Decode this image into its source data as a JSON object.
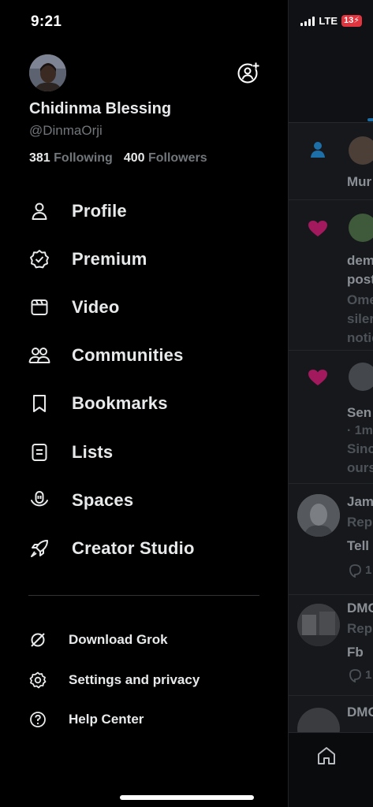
{
  "status_bar": {
    "time": "9:21",
    "network": "LTE",
    "battery": "13"
  },
  "profile": {
    "name": "Chidinma Blessing",
    "handle": "@DinmaOrji",
    "following_count": "381",
    "following_label": "Following",
    "followers_count": "400",
    "followers_label": "Followers"
  },
  "menu": {
    "items": [
      {
        "label": "Profile",
        "icon": "person-icon"
      },
      {
        "label": "Premium",
        "icon": "verified-badge-icon"
      },
      {
        "label": "Video",
        "icon": "video-icon"
      },
      {
        "label": "Communities",
        "icon": "communities-icon"
      },
      {
        "label": "Bookmarks",
        "icon": "bookmark-icon"
      },
      {
        "label": "Lists",
        "icon": "list-icon"
      },
      {
        "label": "Spaces",
        "icon": "spaces-icon"
      },
      {
        "label": "Creator Studio",
        "icon": "rocket-icon"
      }
    ],
    "secondary": [
      {
        "label": "Download Grok",
        "icon": "grok-icon"
      },
      {
        "label": "Settings and privacy",
        "icon": "gear-icon"
      },
      {
        "label": "Help Center",
        "icon": "help-icon"
      }
    ]
  },
  "background_feed": {
    "row1": "Mur",
    "row2_a": "dem",
    "row2_b": "post",
    "row2_c": "Ome",
    "row2_d": "siler",
    "row2_e": "notic",
    "row3_a": "Sen",
    "row3_b": "· 1m",
    "row3_c": "Sinc",
    "row3_d": "ours",
    "row4_a": "Jam",
    "row4_b": "Rep",
    "row4_c": "Tell",
    "row4_d": "1",
    "row5_a": "DMC",
    "row5_b": "Rep",
    "row5_c": "Fb",
    "row5_d": "1",
    "row6_a": "DMC"
  },
  "colors": {
    "background": "#000000",
    "text_primary": "#e7e9ea",
    "text_secondary": "#71767b",
    "like_pink": "#f91880",
    "accent_blue": "#1d9bf0"
  }
}
